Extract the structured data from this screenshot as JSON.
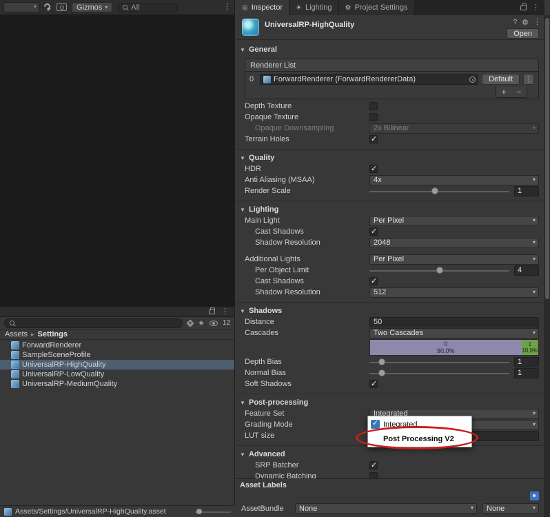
{
  "colors": {
    "background": "#383838",
    "chrome": "#2d2d2d",
    "field": "#2a2a2a",
    "selection": "#4d5e71",
    "cascade_0": "#8d89ac",
    "cascade_1": "#6fa04a",
    "popup_accent": "#3879b5",
    "annotation_red": "#c9201d",
    "label_icon_blue": "#3b76c6"
  },
  "icons": {
    "foldout": "▼",
    "kebab": "⋮",
    "star": "★",
    "sun": "☀",
    "gear": "⚙",
    "target": "◎",
    "help": "?",
    "gizmos_arrow": "▾"
  },
  "scene_toolbar": {
    "gizmos": "Gizmos",
    "search_value": "All"
  },
  "project": {
    "breadcrumb_root": "Assets",
    "breadcrumb_current": "Settings",
    "eye_count": "12",
    "items": [
      {
        "label": "ForwardRenderer"
      },
      {
        "label": "SampleSceneProfile"
      },
      {
        "label": "UniversalRP-HighQuality"
      },
      {
        "label": "UniversalRP-LowQuality"
      },
      {
        "label": "UniversalRP-MediumQuality"
      }
    ],
    "status_path": "Assets/Settings/UniversalRP-HighQuality.asset"
  },
  "tabs": [
    {
      "label": "Inspector"
    },
    {
      "label": "Lighting"
    },
    {
      "label": "Project Settings"
    }
  ],
  "header": {
    "title": "UniversalRP-HighQuality",
    "open_button": "Open"
  },
  "general": {
    "title": "General",
    "renderer_list": "Renderer List",
    "renderer_index": "0",
    "renderer_object": "ForwardRenderer (ForwardRendererData)",
    "default_button": "Default",
    "add_button": "+",
    "remove_button": "−",
    "rows": {
      "depth_texture": "Depth Texture",
      "opaque_texture": "Opaque Texture",
      "opaque_downsampling": "Opaque Downsampling",
      "opaque_downsampling_value": "2x Bilinear",
      "terrain_holes": "Terrain Holes"
    }
  },
  "quality": {
    "title": "Quality",
    "hdr": "HDR",
    "msaa": "Anti Aliasing (MSAA)",
    "msaa_value": "4x",
    "render_scale": "Render Scale",
    "render_scale_value": "1"
  },
  "lighting": {
    "title": "Lighting",
    "main_light": "Main Light",
    "main_light_value": "Per Pixel",
    "cast_shadows": "Cast Shadows",
    "shadow_resolution": "Shadow Resolution",
    "shadow_resolution_value": "2048",
    "additional_lights": "Additional Lights",
    "additional_lights_value": "Per Pixel",
    "per_object_limit": "Per Object Limit",
    "per_object_limit_value": "4",
    "cast_shadows_2": "Cast Shadows",
    "shadow_resolution_2": "Shadow Resolution",
    "shadow_resolution_2_value": "512"
  },
  "shadows": {
    "title": "Shadows",
    "distance": "Distance",
    "distance_value": "50",
    "cascades": "Cascades",
    "cascades_value": "Two Cascades",
    "cascade_0_index": "0",
    "cascade_0_percent": "90,0%",
    "cascade_1_index": "1",
    "cascade_1_percent": "10,0%",
    "depth_bias": "Depth Bias",
    "depth_bias_value": "1",
    "normal_bias": "Normal Bias",
    "normal_bias_value": "1",
    "soft_shadows": "Soft Shadows"
  },
  "post": {
    "title": "Post-processing",
    "feature_set": "Feature Set",
    "feature_set_value": "Integrated",
    "grading_mode": "Grading Mode",
    "lut_size": "LUT size"
  },
  "advanced": {
    "title": "Advanced",
    "srp_batcher": "SRP Batcher",
    "dynamic_batching": "Dynamic Batching"
  },
  "popup": {
    "items": [
      "Integrated",
      "Post Processing V2"
    ]
  },
  "footer": {
    "asset_labels": "Asset Labels",
    "asset_bundle": "AssetBundle",
    "bundle_value": "None",
    "variant_value": "None"
  }
}
